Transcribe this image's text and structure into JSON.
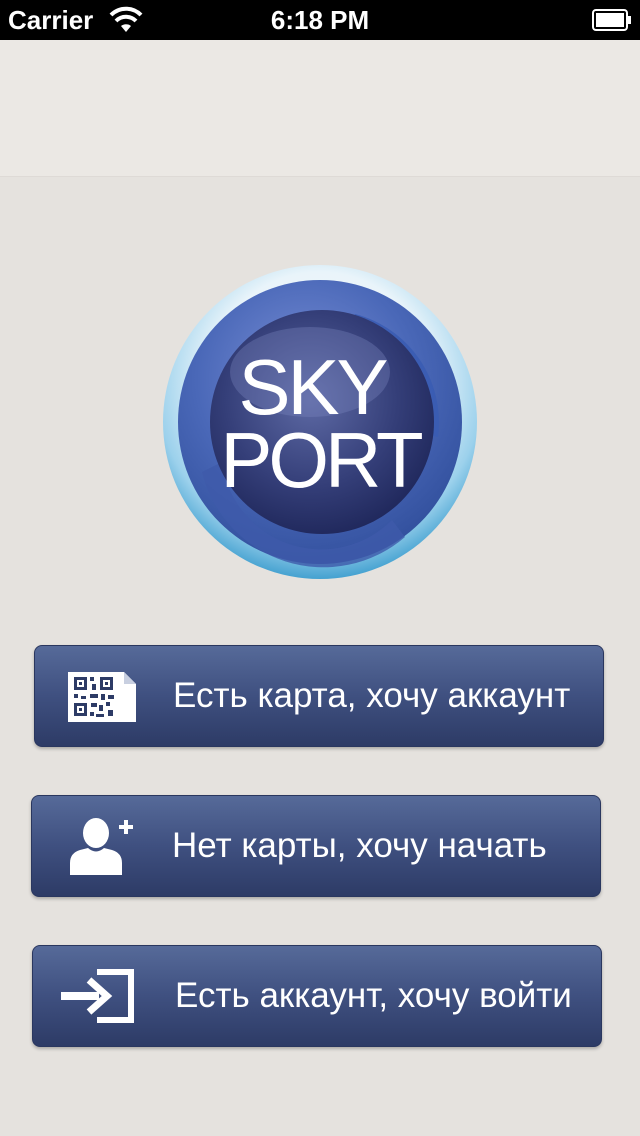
{
  "status_bar": {
    "carrier": "Carrier",
    "time": "6:18 PM"
  },
  "logo": {
    "line1": "SKY",
    "line2": "PORT"
  },
  "buttons": [
    {
      "label": "Есть карта, хочу аккаунт",
      "icon": "qr-card-icon"
    },
    {
      "label": "Нет карты, хочу начать",
      "icon": "add-user-icon"
    },
    {
      "label": "Есть аккаунт, хочу войти",
      "icon": "sign-in-icon"
    }
  ],
  "colors": {
    "background": "#e5e2de",
    "button": "#3f5080",
    "logo_ring": "#4a68b8"
  }
}
